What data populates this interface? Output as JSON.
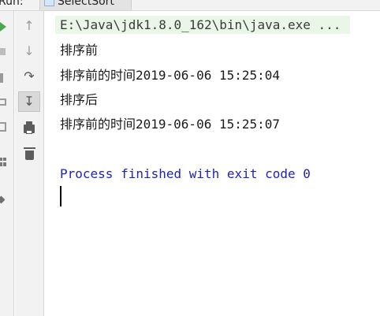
{
  "run_panel": {
    "label": "Run:",
    "tab_label": "SelectSort"
  },
  "left_toolbar": {
    "icons": [
      "run-icon",
      "stop-icon",
      "pause-icon",
      "camera-icon",
      "login-icon",
      "layout-icon",
      "pin-icon"
    ]
  },
  "console_toolbar": {
    "icons": [
      "up-arrow-icon",
      "down-arrow-icon",
      "soft-wrap-icon",
      "scroll-to-end-icon",
      "print-icon",
      "trash-icon"
    ]
  },
  "console": {
    "command": "E:\\Java\\jdk1.8.0_162\\bin\\java.exe ...",
    "lines": [
      "排序前",
      "排序前的时间2019-06-06 15:25:04",
      "排序后",
      "排序前的时间2019-06-06 15:25:07"
    ],
    "process_message": "Process finished with exit code 0"
  },
  "colors": {
    "command_highlight": "#eaf6e8",
    "process_text": "#1f24b8",
    "run_green": "#4aa84f"
  }
}
